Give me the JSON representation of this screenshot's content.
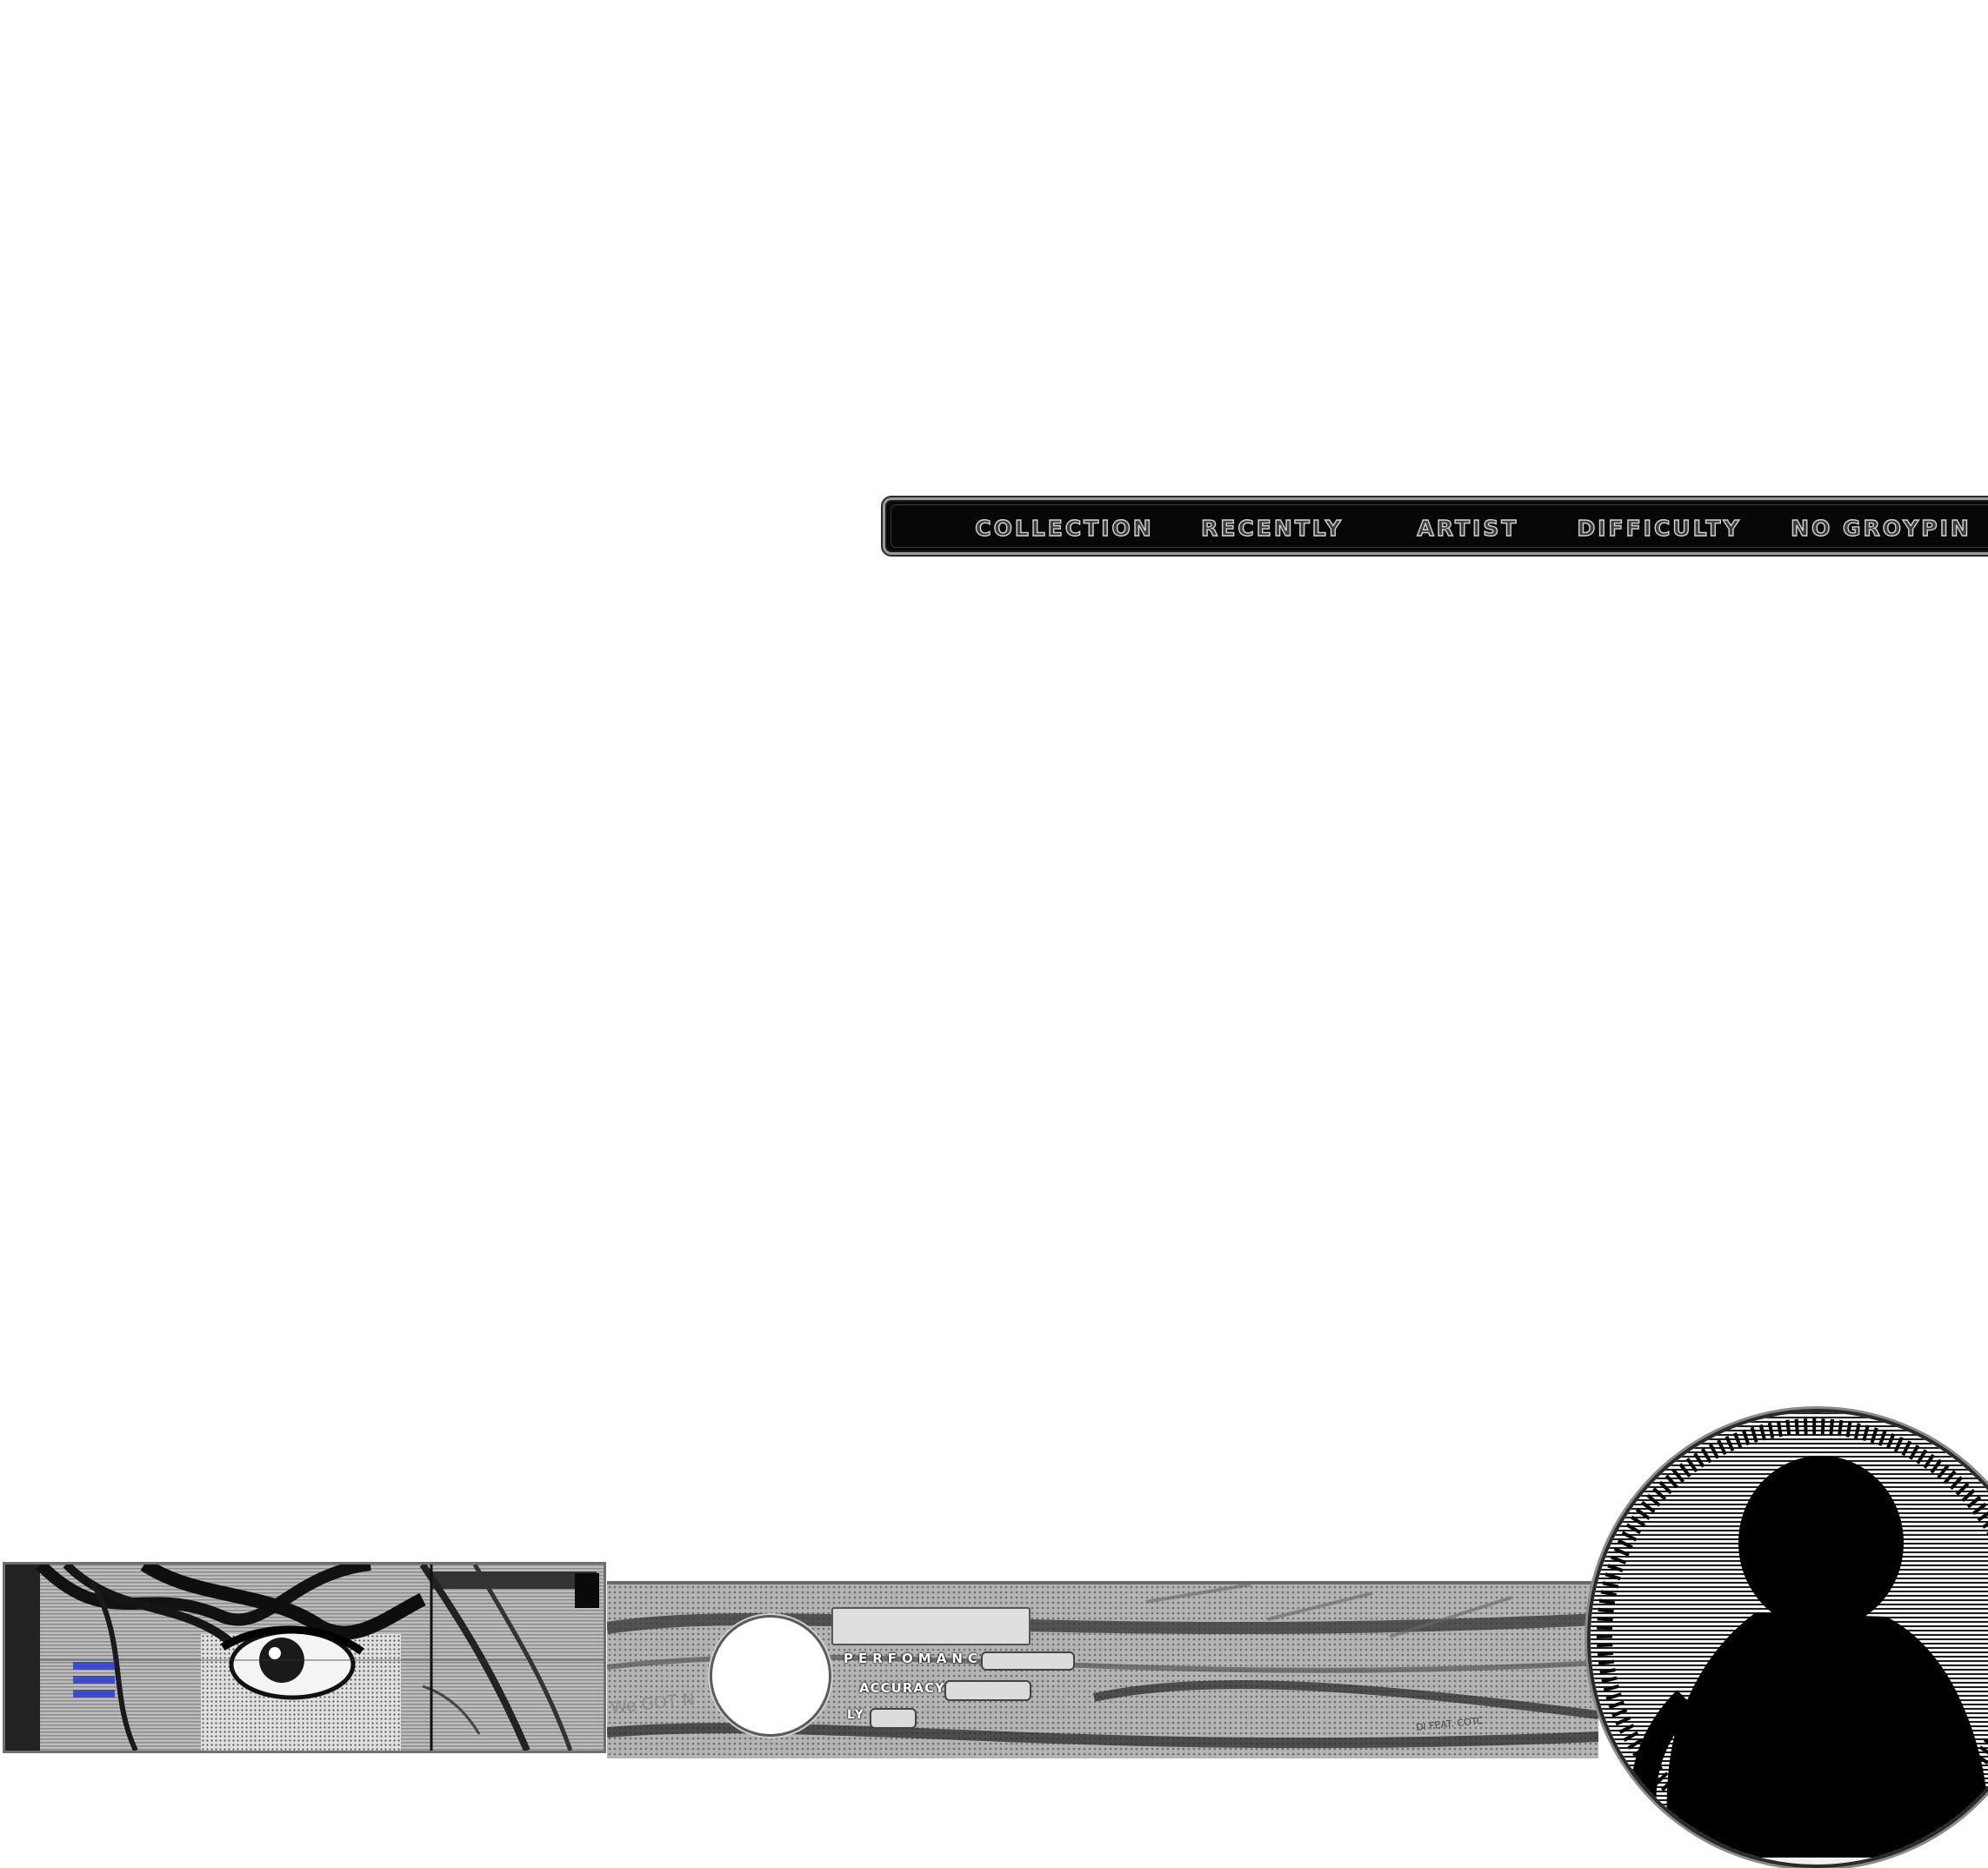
{
  "category_bar": {
    "items": [
      {
        "label": "COLLECTION"
      },
      {
        "label": "RECENTLY"
      },
      {
        "label": "ARTIST"
      },
      {
        "label": "DIFFICULTY"
      },
      {
        "label": "NO GROYPIN"
      }
    ]
  },
  "song_panel": {
    "performance_label": "PERFOMANC",
    "accuracy_label": "ACCURACY",
    "play_label": "LY",
    "performance_value": "",
    "accuracy_value": "",
    "play_value": "",
    "song_title": "",
    "background_text_left": "We GOT N",
    "background_text_right": "DI FEAT. COTC"
  },
  "icons": {
    "album_art": "anime-eye-illustration",
    "portrait": "character-silhouette-icon",
    "grade": "grade-circle",
    "menu": "hamburger-menu-icon"
  },
  "colors": {
    "bar_background": "#070707",
    "label_fill": "#3c3c3c",
    "label_outline": "#d2d2d2",
    "accent_blue": "#2a3bd0"
  }
}
